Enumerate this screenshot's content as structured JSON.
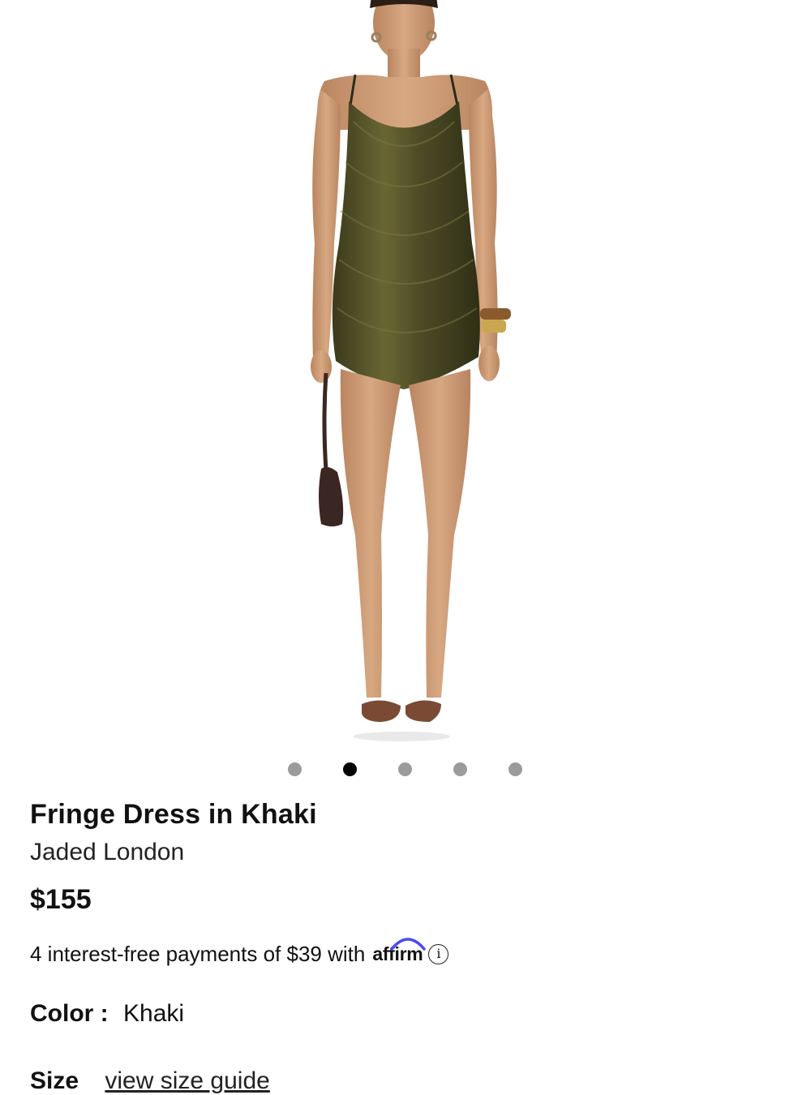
{
  "product": {
    "title": "Fringe Dress in Khaki",
    "brand": "Jaded London",
    "price": "$155",
    "installments_text": "4 interest-free payments of $39 with",
    "affirm_label": "affirm",
    "info_glyph": "i",
    "color_label": "Color :",
    "color_value": "Khaki",
    "size_label": "Size",
    "size_guide_link": "view size guide"
  },
  "gallery": {
    "total_images": 5,
    "active_index": 2,
    "image_subject": "model-front-view",
    "dress_color": "#4b4a25",
    "skin_color": "#d2a27d",
    "bag_color": "#3a2622",
    "shoe_color": "#7b4a34"
  },
  "colors": {
    "active_dot": "#000000",
    "inactive_dot": "#9b9b9b",
    "affirm_blue": "#4a4af4"
  }
}
